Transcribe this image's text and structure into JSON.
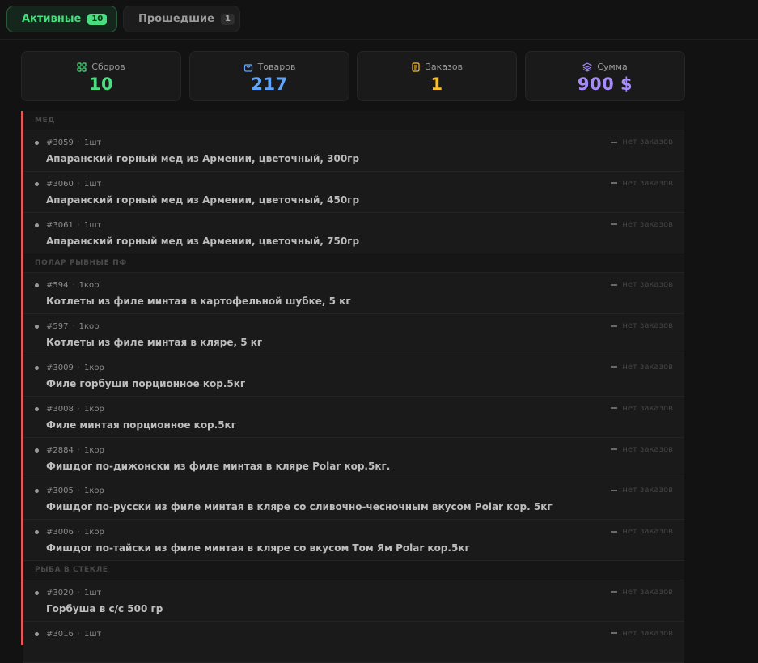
{
  "tabs": [
    {
      "label": "Активные",
      "count": "10"
    },
    {
      "label": "Прошедшие",
      "count": "1"
    }
  ],
  "stats": [
    {
      "label": "Сборов",
      "value": "10",
      "color": "#4ade80",
      "icon": "grid-icon"
    },
    {
      "label": "Товаров",
      "value": "217",
      "color": "#60a5fa",
      "icon": "bag-icon"
    },
    {
      "label": "Заказов",
      "value": "1",
      "color": "#fbbf24",
      "icon": "document-icon"
    },
    {
      "label": "Сумма",
      "value": "900 $",
      "color": "#a78bfa",
      "icon": "layers-icon"
    }
  ],
  "groups": [
    {
      "title": "МЕД",
      "items": [
        {
          "id": "#3059",
          "qty": "1шт",
          "name": "Апаранский горный мед из Армении, цветочный, 300гр",
          "orders": "нет заказов"
        },
        {
          "id": "#3060",
          "qty": "1шт",
          "name": "Апаранский горный мед из Армении, цветочный, 450гр",
          "orders": "нет заказов"
        },
        {
          "id": "#3061",
          "qty": "1шт",
          "name": "Апаранский горный мед из Армении, цветочный, 750гр",
          "orders": "нет заказов"
        }
      ]
    },
    {
      "title": "ПОЛАР РЫБНЫЕ ПФ",
      "items": [
        {
          "id": "#594",
          "qty": "1кор",
          "name": "Котлеты из филе минтая в картофельной шубке, 5 кг",
          "orders": "нет заказов"
        },
        {
          "id": "#597",
          "qty": "1кор",
          "name": "Котлеты из филе минтая в кляре, 5 кг",
          "orders": "нет заказов"
        },
        {
          "id": "#3009",
          "qty": "1кор",
          "name": "Филе горбуши порционное кор.5кг",
          "orders": "нет заказов"
        },
        {
          "id": "#3008",
          "qty": "1кор",
          "name": "Филе минтая порционное кор.5кг",
          "orders": "нет заказов"
        },
        {
          "id": "#2884",
          "qty": "1кор",
          "name": "Фишдог по-дижонски из филе минтая в кляре Polar кор.5кг.",
          "orders": "нет заказов"
        },
        {
          "id": "#3005",
          "qty": "1кор",
          "name": "Фишдог по-русски из филе минтая в кляре со сливочно-чесночным вкусом Polar кор. 5кг",
          "orders": "нет заказов"
        },
        {
          "id": "#3006",
          "qty": "1кор",
          "name": "Фишдог по-тайски из филе минтая в кляре со вкусом Том Ям Polar кор.5кг",
          "orders": "нет заказов"
        }
      ]
    },
    {
      "title": "РЫБА В СТЕКЛЕ",
      "items": [
        {
          "id": "#3020",
          "qty": "1шт",
          "name": "Горбуша в с/с 500 гр",
          "orders": "нет заказов"
        },
        {
          "id": "#3016",
          "qty": "1шт",
          "name": "",
          "orders": "нет заказов"
        }
      ]
    }
  ]
}
